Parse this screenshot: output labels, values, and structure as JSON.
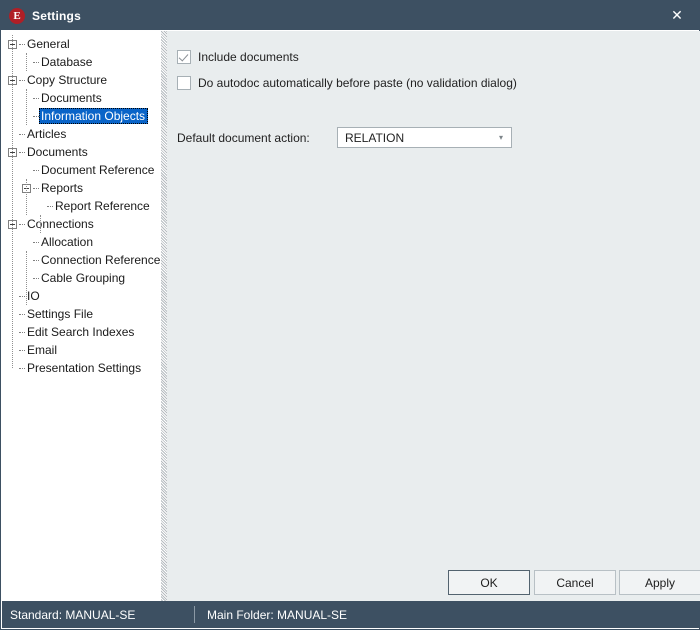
{
  "titlebar": {
    "icon": "e-logo-icon",
    "title": "Settings",
    "close_label": "✕"
  },
  "tree": {
    "selected": "Information Objects",
    "items": [
      {
        "label": "General",
        "level": 0,
        "expander": "minus"
      },
      {
        "label": "Database",
        "level": 1,
        "expander": "none"
      },
      {
        "label": "Copy Structure",
        "level": 0,
        "expander": "minus"
      },
      {
        "label": "Documents",
        "level": 1,
        "expander": "none"
      },
      {
        "label": "Information Objects",
        "level": 1,
        "expander": "none"
      },
      {
        "label": "Articles",
        "level": 0,
        "expander": "none"
      },
      {
        "label": "Documents",
        "level": 0,
        "expander": "minus"
      },
      {
        "label": "Document Reference",
        "level": 1,
        "expander": "none"
      },
      {
        "label": "Reports",
        "level": 1,
        "expander": "minus"
      },
      {
        "label": "Report Reference",
        "level": 2,
        "expander": "none"
      },
      {
        "label": "Connections",
        "level": 0,
        "expander": "minus"
      },
      {
        "label": "Allocation",
        "level": 1,
        "expander": "none"
      },
      {
        "label": "Connection Reference",
        "level": 1,
        "expander": "none"
      },
      {
        "label": "Cable Grouping",
        "level": 1,
        "expander": "none"
      },
      {
        "label": "IO",
        "level": 0,
        "expander": "none"
      },
      {
        "label": "Settings File",
        "level": 0,
        "expander": "none"
      },
      {
        "label": "Edit Search Indexes",
        "level": 0,
        "expander": "none"
      },
      {
        "label": "Email",
        "level": 0,
        "expander": "none"
      },
      {
        "label": "Presentation Settings",
        "level": 0,
        "expander": "none"
      }
    ]
  },
  "content": {
    "include_documents": {
      "label": "Include documents",
      "checked": true
    },
    "autodoc": {
      "label": "Do autodoc automatically before paste (no validation dialog)",
      "checked": false
    },
    "default_action": {
      "label": "Default document action:",
      "value": "RELATION",
      "arrow": "▾"
    }
  },
  "buttons": {
    "ok": "OK",
    "cancel": "Cancel",
    "apply": "Apply"
  },
  "statusbar": {
    "left": "Standard: MANUAL-SE",
    "right": "Main Folder: MANUAL-SE"
  },
  "colors": {
    "titlebar": "#3d5062",
    "accent_selection": "#0a64c8",
    "panel_bg": "#e9edee",
    "icon_red": "#b01f26"
  }
}
